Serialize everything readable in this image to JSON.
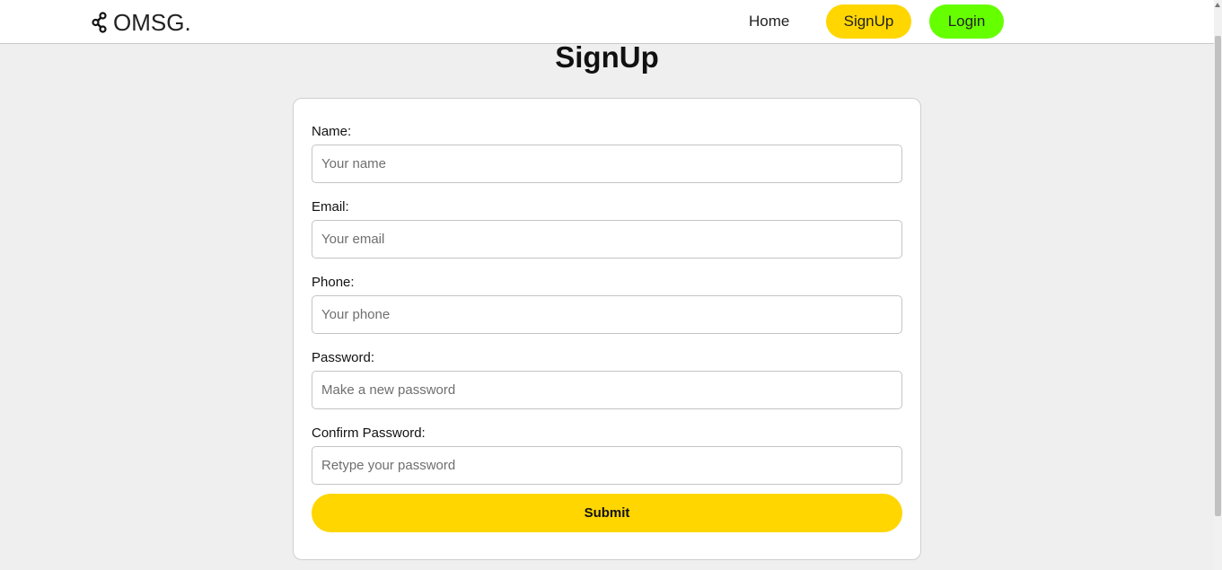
{
  "header": {
    "brand": "OMSG.",
    "brand_icon": "share-icon",
    "nav": {
      "home": "Home",
      "signup": "SignUp",
      "login": "Login"
    }
  },
  "page": {
    "title": "SignUp"
  },
  "form": {
    "fields": [
      {
        "label": "Name:",
        "placeholder": "Your name"
      },
      {
        "label": "Email:",
        "placeholder": "Your email"
      },
      {
        "label": "Phone:",
        "placeholder": "Your phone"
      },
      {
        "label": "Password:",
        "placeholder": "Make a new password"
      },
      {
        "label": "Confirm Password:",
        "placeholder": "Retype your password"
      }
    ],
    "submit_label": "Submit"
  },
  "colors": {
    "accent_yellow": "#ffd600",
    "accent_green": "#66ff00",
    "page_background": "#efefef"
  }
}
